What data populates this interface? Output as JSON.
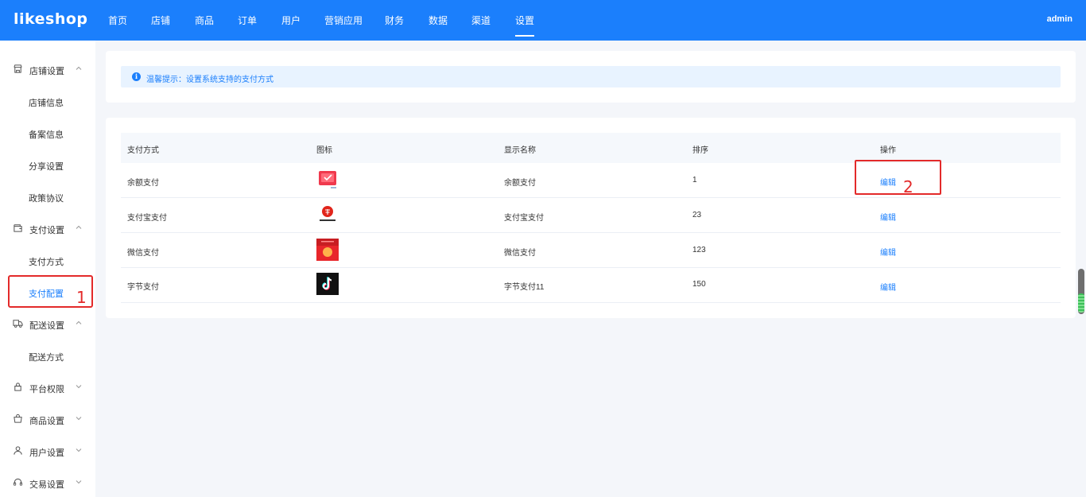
{
  "topbar": {
    "logo": "likeshop",
    "nav": [
      "首页",
      "店铺",
      "商品",
      "订单",
      "用户",
      "营销应用",
      "财务",
      "数据",
      "渠道",
      "设置"
    ],
    "active": "设置",
    "user": "admin"
  },
  "sidebar": {
    "groups": [
      {
        "label": "店铺设置",
        "icon": "store-icon",
        "expanded": true,
        "items": [
          "店铺信息",
          "备案信息",
          "分享设置",
          "政策协议"
        ]
      },
      {
        "label": "支付设置",
        "icon": "wallet-icon",
        "expanded": true,
        "items": [
          "支付方式",
          "支付配置"
        ]
      },
      {
        "label": "配送设置",
        "icon": "truck-icon",
        "expanded": true,
        "items": [
          "配送方式"
        ]
      },
      {
        "label": "平台权限",
        "icon": "lock-icon",
        "expanded": false,
        "items": []
      },
      {
        "label": "商品设置",
        "icon": "bag-icon",
        "expanded": false,
        "items": []
      },
      {
        "label": "用户设置",
        "icon": "user-icon",
        "expanded": false,
        "items": []
      },
      {
        "label": "交易设置",
        "icon": "headset-icon",
        "expanded": false,
        "items": []
      }
    ],
    "active_item": "支付配置"
  },
  "tip": {
    "text": "温馨提示：设置系统支持的支付方式"
  },
  "table": {
    "headers": [
      "支付方式",
      "图标",
      "显示名称",
      "排序",
      "操作"
    ],
    "rows": [
      {
        "method": "余额支付",
        "icon": "balance-pay-icon",
        "display_name": "余额支付",
        "sort": "1",
        "action": "编辑"
      },
      {
        "method": "支付宝支付",
        "icon": "alipay-icon",
        "display_name": "支付宝支付",
        "sort": "23",
        "action": "编辑"
      },
      {
        "method": "微信支付",
        "icon": "wechat-pay-icon",
        "display_name": "微信支付",
        "sort": "123",
        "action": "编辑"
      },
      {
        "method": "字节支付",
        "icon": "bytedance-pay-icon",
        "display_name": "字节支付11",
        "sort": "150",
        "action": "编辑"
      }
    ]
  },
  "annotations": {
    "one": "1",
    "two": "2"
  },
  "colors": {
    "primary": "#1b7ffc",
    "annotation": "#e32a2a",
    "background": "#f4f6fa"
  }
}
